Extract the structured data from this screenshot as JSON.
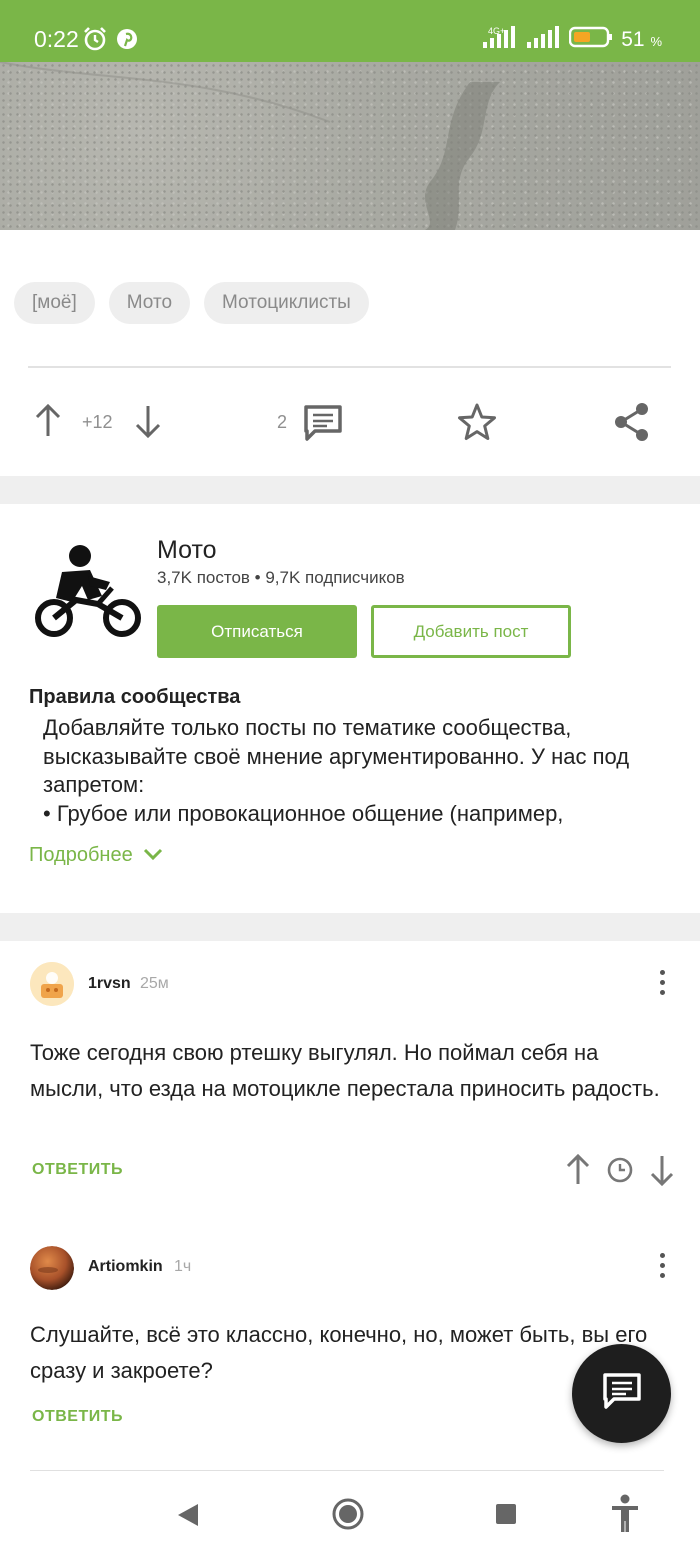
{
  "status_bar": {
    "time": "0:22",
    "network": "4G+",
    "battery_percent": "51",
    "battery_unit": "%",
    "background_color": "#7ab648"
  },
  "tags": [
    "[моё]",
    "Мото",
    "Мотоциклисты"
  ],
  "post_actions": {
    "rating": "+12",
    "comments_count": "2"
  },
  "community": {
    "title": "Мото",
    "stats": "3,7K постов • 9,7K подписчиков",
    "unsubscribe_label": "Отписаться",
    "add_post_label": "Добавить пост",
    "rules_title": "Правила сообщества",
    "rules_text": "Добавляйте только посты по тематике сообщества, высказывайте своё мнение аргументированно. У нас под запретом:\n• Грубое или провокационное общение (например,",
    "more_label": "Подробнее"
  },
  "comments": [
    {
      "user": "1rvsn",
      "time": "25м",
      "text": "Тоже сегодня свою ртешку выгулял. Но поймал себя на мысли, что езда на мотоцикле перестала приносить радость.",
      "reply_label": "ОТВЕТИТЬ"
    },
    {
      "user": "Artiomkin",
      "time": "1ч",
      "text": "Слушайте, всё это классно, конечно, но, может быть, вы его сразу и закроете?",
      "reply_label": "ОТВЕТИТЬ"
    }
  ],
  "colors": {
    "accent": "#7ab648",
    "muted": "#8f8f8f",
    "fab": "#1e1e1e"
  }
}
